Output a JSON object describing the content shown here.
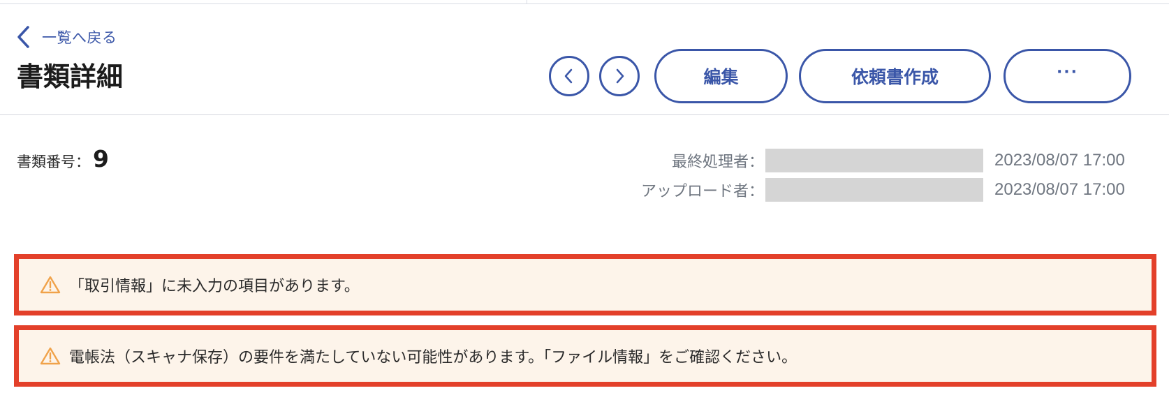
{
  "header": {
    "back_label": "一覧へ戻る",
    "title": "書類詳細"
  },
  "toolbar": {
    "prev_icon": "chevron-left-icon",
    "next_icon": "chevron-right-icon",
    "edit_label": "編集",
    "create_request_label": "依頼書作成",
    "more_label": "···"
  },
  "document": {
    "number_label": "書類番号：",
    "number_value": "9"
  },
  "meta": {
    "last_processor_label": "最終処理者：",
    "last_processor_time": "2023/08/07 17:00",
    "uploader_label": "アップロード者：",
    "uploader_time": "2023/08/07 17:00"
  },
  "alerts": [
    {
      "icon": "warning-icon",
      "text": "「取引情報」に未入力の項目があります。"
    },
    {
      "icon": "warning-icon",
      "text": "電帳法（スキャナ保存）の要件を満たしていない可能性があります。「ファイル情報」をご確認ください。"
    }
  ],
  "colors": {
    "accent": "#3a56a8",
    "alert_border": "#e3402a",
    "alert_bg": "#fdf4ea",
    "warning_icon": "#f0a24a"
  }
}
